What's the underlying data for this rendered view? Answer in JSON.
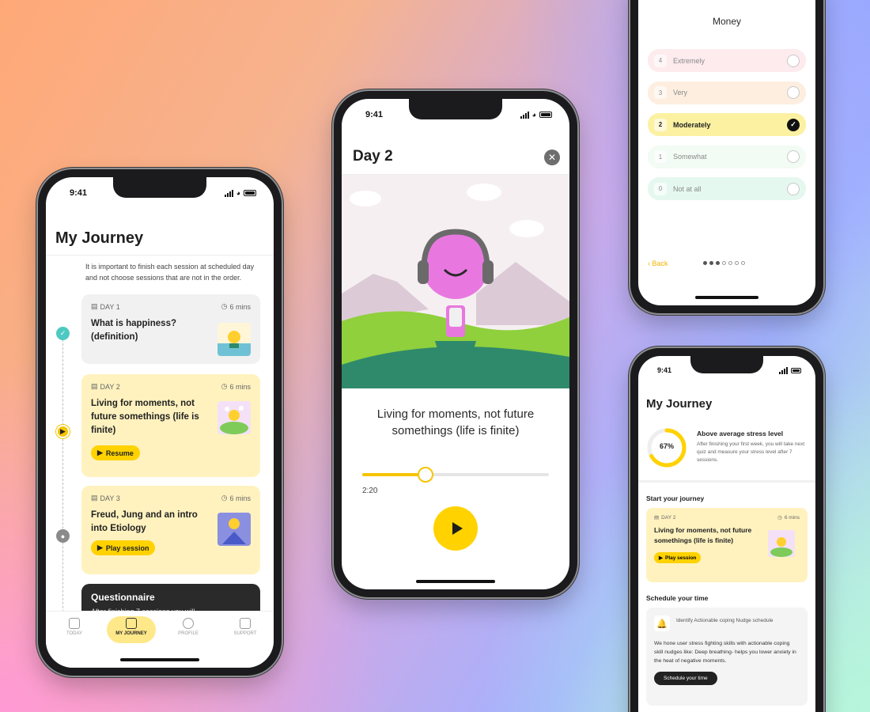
{
  "status_time": "9:41",
  "journey": {
    "title": "My Journey",
    "intro": "It is important to finish each session at scheduled day and not choose sessions that are not in the order.",
    "sessions": [
      {
        "day": "DAY 1",
        "duration": "6 mins",
        "title": "What is happiness? (definition)",
        "state": "done"
      },
      {
        "day": "DAY 2",
        "duration": "6 mins",
        "title": "Living for moments, not future somethings (life is finite)",
        "button": "Resume",
        "state": "active"
      },
      {
        "day": "DAY 3",
        "duration": "6 mins",
        "title": "Freud, Jung and an intro into Etiology",
        "button": "Play session",
        "state": "locked"
      }
    ],
    "questionnaire": {
      "title": "Questionnaire",
      "text": "After finishing 7 sessions you will"
    },
    "tabs": [
      {
        "label": "TODAY",
        "icon": "calendar-icon"
      },
      {
        "label": "MY JOURNEY",
        "icon": "journey-icon",
        "active": true
      },
      {
        "label": "PROFILE",
        "icon": "profile-icon"
      },
      {
        "label": "SUPPORT",
        "icon": "support-icon"
      }
    ]
  },
  "player": {
    "title": "Day 2",
    "track_title": "Living for moments, not future somethings (life is finite)",
    "elapsed": "2:20",
    "progress": 0.34,
    "colors": {
      "accent": "#ffd200",
      "character": "#e878e0",
      "hill": "#8fd03c"
    }
  },
  "quiz": {
    "title": "Money",
    "options": [
      {
        "num": "4",
        "label": "Extremely",
        "color": "#fdebee"
      },
      {
        "num": "3",
        "label": "Very",
        "color": "#fdeee0"
      },
      {
        "num": "2",
        "label": "Moderately",
        "color": "#fbf1a0",
        "selected": true
      },
      {
        "num": "1",
        "label": "Somewhat",
        "color": "#f2fbf4"
      },
      {
        "num": "0",
        "label": "Not at all",
        "color": "#e5f8ef"
      }
    ],
    "back": "Back",
    "page_index": 3,
    "page_total": 7
  },
  "overview": {
    "title": "My Journey",
    "stress": {
      "value": 0.67,
      "percent": "67%",
      "title": "Above average stress level",
      "text": "After finishing your first week, you will take next quiz and measure your stress level after 7 sessions."
    },
    "start_heading": "Start your journey",
    "card": {
      "day": "DAY 2",
      "duration": "6 mins",
      "title": "Living for moments, not future somethings (life is finite)",
      "button": "Play session"
    },
    "schedule_heading": "Schedule your time",
    "schedule": {
      "title": "Identify Actionable coping Nudge schedule",
      "text": "We hone user stress fighting skills with actionable coping skill nudges like: Deep breathing- helps you lower anxiety in the heat of negative moments.",
      "button": "Schedule your time"
    }
  }
}
